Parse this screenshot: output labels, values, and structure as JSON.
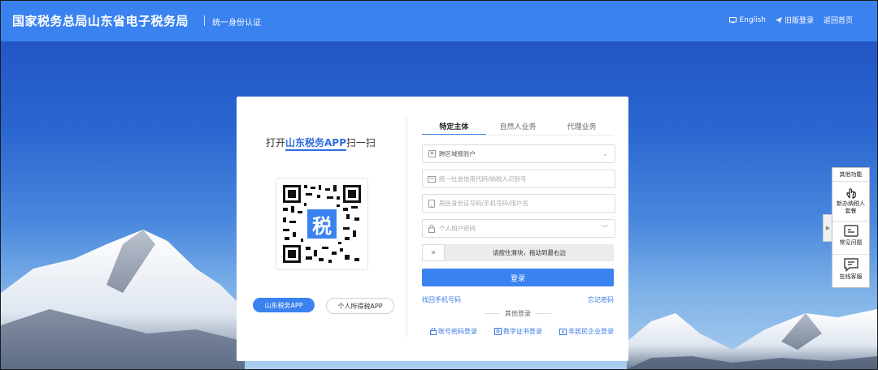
{
  "header": {
    "title": "国家税务总局山东省电子税务局",
    "subtitle": "统一身份认证",
    "links": [
      {
        "icon": "monitor-icon",
        "label": "English"
      },
      {
        "icon": "send-icon",
        "label": "旧版登录"
      },
      {
        "icon": "",
        "label": "返回首页"
      }
    ]
  },
  "scan": {
    "prefix": "打开",
    "brand": "山东税务APP",
    "suffix": "扫一扫",
    "qr_center_char": "税",
    "apps": [
      "山东税务APP",
      "个人所得税APP"
    ]
  },
  "login": {
    "tabs": [
      "特定主体",
      "自然人业务",
      "代理业务"
    ],
    "active_tab": 0,
    "region_select": "跨区域报验户",
    "tax_id_placeholder": "统一社会信用代码/纳税人识别号",
    "id_placeholder": "居民身份证号码/手机号码/用户名",
    "password_placeholder": "个人用户密码",
    "slider_text": "请按住滑块，拖动到最右边",
    "submit_label": "登录",
    "forgot_phone": "找回手机号码",
    "forgot_password": "忘记密码",
    "other_label": "其他登录",
    "alt_logins": [
      {
        "icon": "lock-icon",
        "label": "账号密码登录"
      },
      {
        "icon": "certificate-icon",
        "label": "数字证书登录"
      },
      {
        "icon": "building-icon",
        "label": "非居民企业登录"
      }
    ]
  },
  "side_panel": {
    "title": "其他功能",
    "items": [
      {
        "icon": "hand-pointer-icon",
        "label": "新办纳税人套餐"
      },
      {
        "icon": "faq-icon",
        "label": "常见问题"
      },
      {
        "icon": "chat-icon",
        "label": "在线客服"
      }
    ]
  },
  "colors": {
    "primary": "#3a82ef",
    "link": "#3a7be0"
  }
}
